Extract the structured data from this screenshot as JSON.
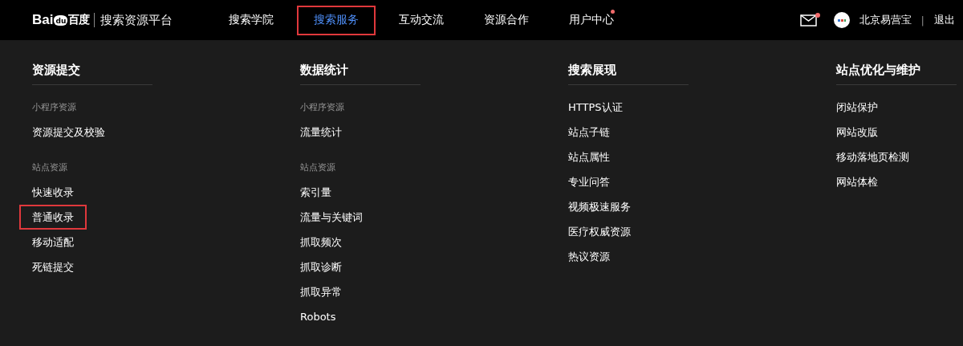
{
  "header": {
    "logo": {
      "latin_1": "Bai",
      "paw": "du",
      "chinese": "百度"
    },
    "platform": "搜索资源平台",
    "nav": [
      {
        "label": "搜索学院",
        "selected": false,
        "highlighted": false,
        "badge": false
      },
      {
        "label": "搜索服务",
        "selected": true,
        "highlighted": true,
        "badge": false
      },
      {
        "label": "互动交流",
        "selected": false,
        "highlighted": false,
        "badge": false
      },
      {
        "label": "资源合作",
        "selected": false,
        "highlighted": false,
        "badge": false
      },
      {
        "label": "用户中心",
        "selected": false,
        "highlighted": false,
        "badge": true
      }
    ],
    "mail_badge": true,
    "user": "北京易营宝",
    "separator": "|",
    "logout": "退出"
  },
  "menu": {
    "columns": [
      {
        "title": "资源提交",
        "items": [
          {
            "kind": "group",
            "label": "小程序资源",
            "highlighted": false
          },
          {
            "kind": "link",
            "label": "资源提交及校验",
            "highlighted": false
          },
          {
            "kind": "group",
            "label": "站点资源",
            "highlighted": false
          },
          {
            "kind": "link",
            "label": "快速收录",
            "highlighted": false
          },
          {
            "kind": "link",
            "label": "普通收录",
            "highlighted": true
          },
          {
            "kind": "link",
            "label": "移动适配",
            "highlighted": false
          },
          {
            "kind": "link",
            "label": "死链提交",
            "highlighted": false
          }
        ]
      },
      {
        "title": "数据统计",
        "items": [
          {
            "kind": "group",
            "label": "小程序资源",
            "highlighted": false
          },
          {
            "kind": "link",
            "label": "流量统计",
            "highlighted": false
          },
          {
            "kind": "group",
            "label": "站点资源",
            "highlighted": false
          },
          {
            "kind": "link",
            "label": "索引量",
            "highlighted": false
          },
          {
            "kind": "link",
            "label": "流量与关键词",
            "highlighted": false
          },
          {
            "kind": "link",
            "label": "抓取频次",
            "highlighted": false
          },
          {
            "kind": "link",
            "label": "抓取诊断",
            "highlighted": false
          },
          {
            "kind": "link",
            "label": "抓取异常",
            "highlighted": false
          },
          {
            "kind": "link",
            "label": "Robots",
            "highlighted": false
          }
        ]
      },
      {
        "title": "搜索展现",
        "items": [
          {
            "kind": "link",
            "label": "HTTPS认证",
            "highlighted": false
          },
          {
            "kind": "link",
            "label": "站点子链",
            "highlighted": false
          },
          {
            "kind": "link",
            "label": "站点属性",
            "highlighted": false
          },
          {
            "kind": "link",
            "label": "专业问答",
            "highlighted": false
          },
          {
            "kind": "link",
            "label": "视频极速服务",
            "highlighted": false
          },
          {
            "kind": "link",
            "label": "医疗权威资源",
            "highlighted": false
          },
          {
            "kind": "link",
            "label": "热议资源",
            "highlighted": false
          }
        ]
      },
      {
        "title": "站点优化与维护",
        "items": [
          {
            "kind": "link",
            "label": "闭站保护",
            "highlighted": false
          },
          {
            "kind": "link",
            "label": "网站改版",
            "highlighted": false
          },
          {
            "kind": "link",
            "label": "移动落地页检测",
            "highlighted": false
          },
          {
            "kind": "link",
            "label": "网站体检",
            "highlighted": false
          }
        ]
      }
    ]
  }
}
